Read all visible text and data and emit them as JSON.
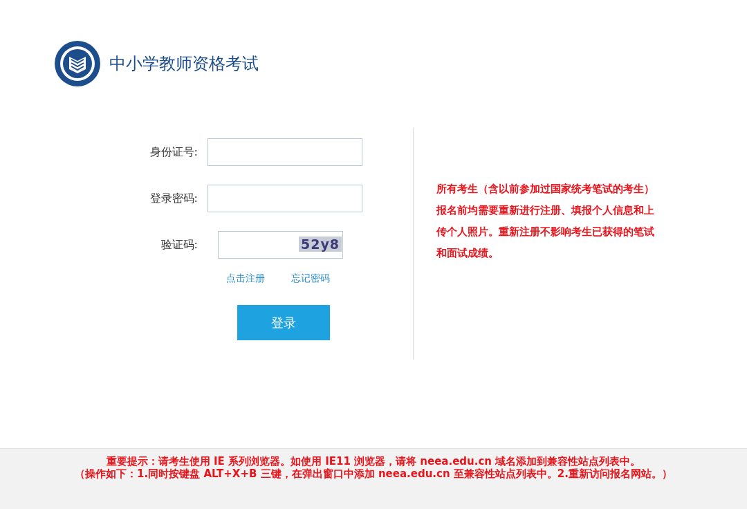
{
  "header": {
    "title": "中小学教师资格考试"
  },
  "form": {
    "fields": [
      {
        "label": "身份证号:",
        "kind": "text"
      },
      {
        "label": "登录密码:",
        "kind": "password"
      },
      {
        "label": "验证码:",
        "kind": "captcha",
        "captcha": "52y8"
      }
    ],
    "links": [
      "点击注册",
      "忘记密码"
    ],
    "submit": "登录"
  },
  "notice": "所有考生（含以前参加过国家统考笔试的考生）报名前均需要重新进行注册、填报个人信息和上传个人照片。重新注册不影响考生已获得的笔试和面试成绩。",
  "footer": [
    "重要提示：请考生使用 IE 系列浏览器。如使用 IE11 浏览器，请将 neea.edu.cn 域名添加到兼容性站点列表中。",
    "（操作如下：1.同时按键盘 ALT+X+B 三键，在弹出窗口中添加 neea.edu.cn 至兼容性站点列表中。2.重新访问报名网站。）"
  ]
}
